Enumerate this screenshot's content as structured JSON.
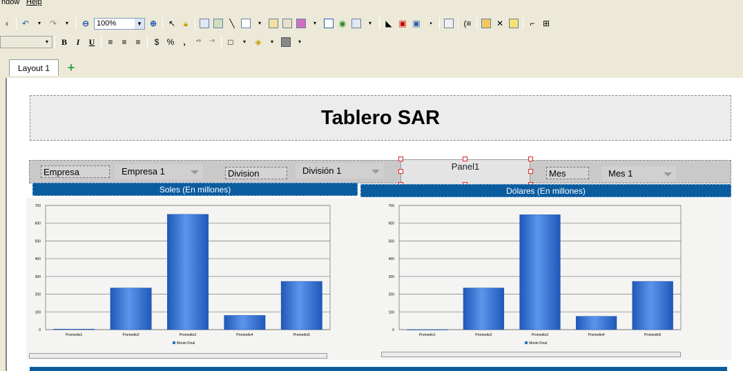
{
  "menu": {
    "items": [
      "ndow",
      "Help"
    ]
  },
  "toolbar": {
    "zoom_value": "100%"
  },
  "format_toolbar": {
    "bold": "B",
    "italic": "I",
    "underline": "U",
    "currency": "$",
    "percent": "%",
    "comma": ","
  },
  "tabs": {
    "active": "Layout 1",
    "add": "+"
  },
  "dashboard": {
    "title": "Tablero SAR",
    "filters": {
      "empresa_label": "Empresa",
      "empresa_value": "Empresa 1",
      "division_label": "Division",
      "division_value": "División 1",
      "panel_label": "Panel1",
      "mes_label": "Mes",
      "mes_value": "Mes 1"
    },
    "left_header": "Soles (En millones)",
    "right_header": "Dólares (En millones)"
  },
  "colors": {
    "header_blue": "#0b5c9e",
    "bar_blue": "#2f6fd0",
    "selection_red": "#d22222"
  },
  "chart_data": [
    {
      "type": "bar",
      "title": "",
      "categories": [
        "Promedio1",
        "Promedio2",
        "Promedio3",
        "Promedio4",
        "Promedio5"
      ],
      "series": [
        {
          "name": "Monto Final",
          "values": [
            3,
            235,
            650,
            80,
            272
          ]
        }
      ],
      "ylim": [
        0,
        700
      ],
      "yticks": [
        0,
        100,
        200,
        300,
        400,
        500,
        600,
        700
      ],
      "grid": true,
      "legend": "bottom-center"
    },
    {
      "type": "bar",
      "title": "",
      "categories": [
        "Promedio1",
        "Promedio2",
        "Promedio3",
        "Promedio4",
        "Promedio5"
      ],
      "series": [
        {
          "name": "Monto Final",
          "values": [
            0,
            235,
            648,
            75,
            272
          ]
        }
      ],
      "ylim": [
        0,
        700
      ],
      "yticks": [
        0,
        100,
        200,
        300,
        400,
        500,
        600,
        700
      ],
      "grid": true,
      "legend": "bottom-center"
    }
  ]
}
